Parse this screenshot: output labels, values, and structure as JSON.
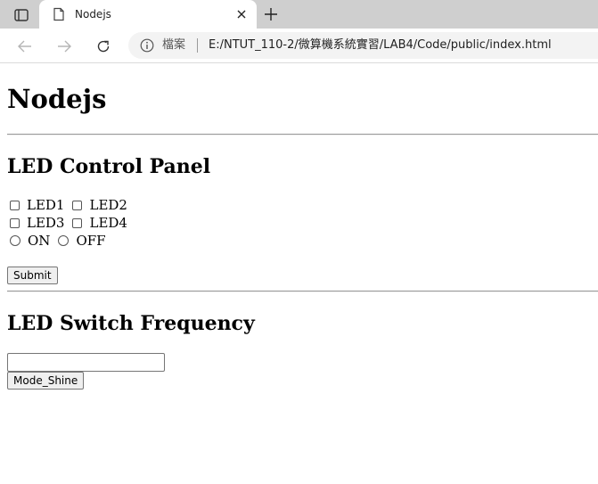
{
  "browser": {
    "tab_title": "Nodejs",
    "scheme_label": "檔案",
    "url": "E:/NTUT_110-2/微算機系統實習/LAB4/Code/public/index.html"
  },
  "page": {
    "heading": "Nodejs",
    "panel": {
      "title": "LED Control Panel",
      "leds": [
        "LED1",
        "LED2",
        "LED3",
        "LED4"
      ],
      "states": [
        "ON",
        "OFF"
      ],
      "submit_label": "Submit"
    },
    "frequency": {
      "title": "LED Switch Frequency",
      "input_value": "",
      "mode_button_label": "Mode_Shine"
    }
  }
}
